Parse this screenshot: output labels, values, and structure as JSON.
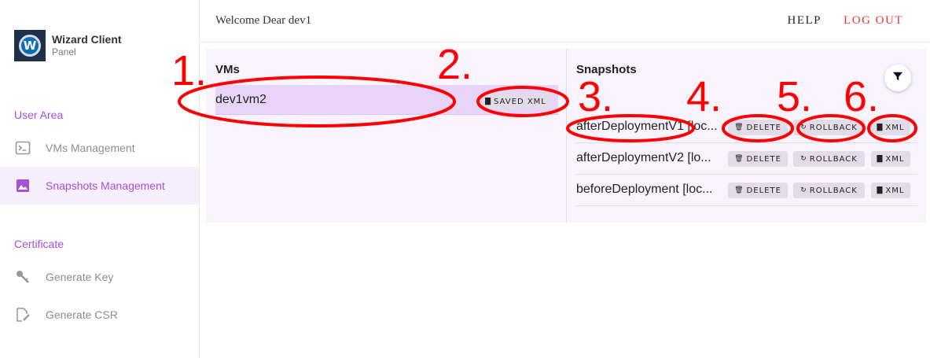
{
  "brand": {
    "name": "Wizard Client",
    "sub": "Panel",
    "logo_letter": "W"
  },
  "sidebar": {
    "sections": [
      {
        "label": "User Area"
      },
      {
        "label": "Certificate"
      }
    ],
    "items": [
      {
        "label": "VMs Management",
        "icon": "terminal-icon"
      },
      {
        "label": "Snapshots Management",
        "icon": "image-icon",
        "active": true
      },
      {
        "label": "Generate Key",
        "icon": "key-icon"
      },
      {
        "label": "Generate CSR",
        "icon": "edit-document-icon"
      }
    ]
  },
  "header": {
    "welcome": "Welcome Dear dev1",
    "help": "HELP",
    "logout": "LOG OUT"
  },
  "vms": {
    "title": "VMs",
    "rows": [
      {
        "name": "dev1vm2",
        "saved_xml_label": "SAVED XML"
      }
    ]
  },
  "snapshots": {
    "title": "Snapshots",
    "delete_label": "DELETE",
    "rollback_label": "ROLLBACK",
    "xml_label": "XML",
    "rows": [
      {
        "name": "afterDeploymentV1 [loc..."
      },
      {
        "name": "afterDeploymentV2 [lo..."
      },
      {
        "name": "beforeDeployment [loc..."
      }
    ]
  },
  "annotations": {
    "labels": [
      "1.",
      "2.",
      "3.",
      "4.",
      "5.",
      "6."
    ],
    "color": "#ff0000"
  },
  "colors": {
    "accent": "#a64fd8",
    "logout": "#e53935",
    "selected_row": "#e8d4f8"
  }
}
